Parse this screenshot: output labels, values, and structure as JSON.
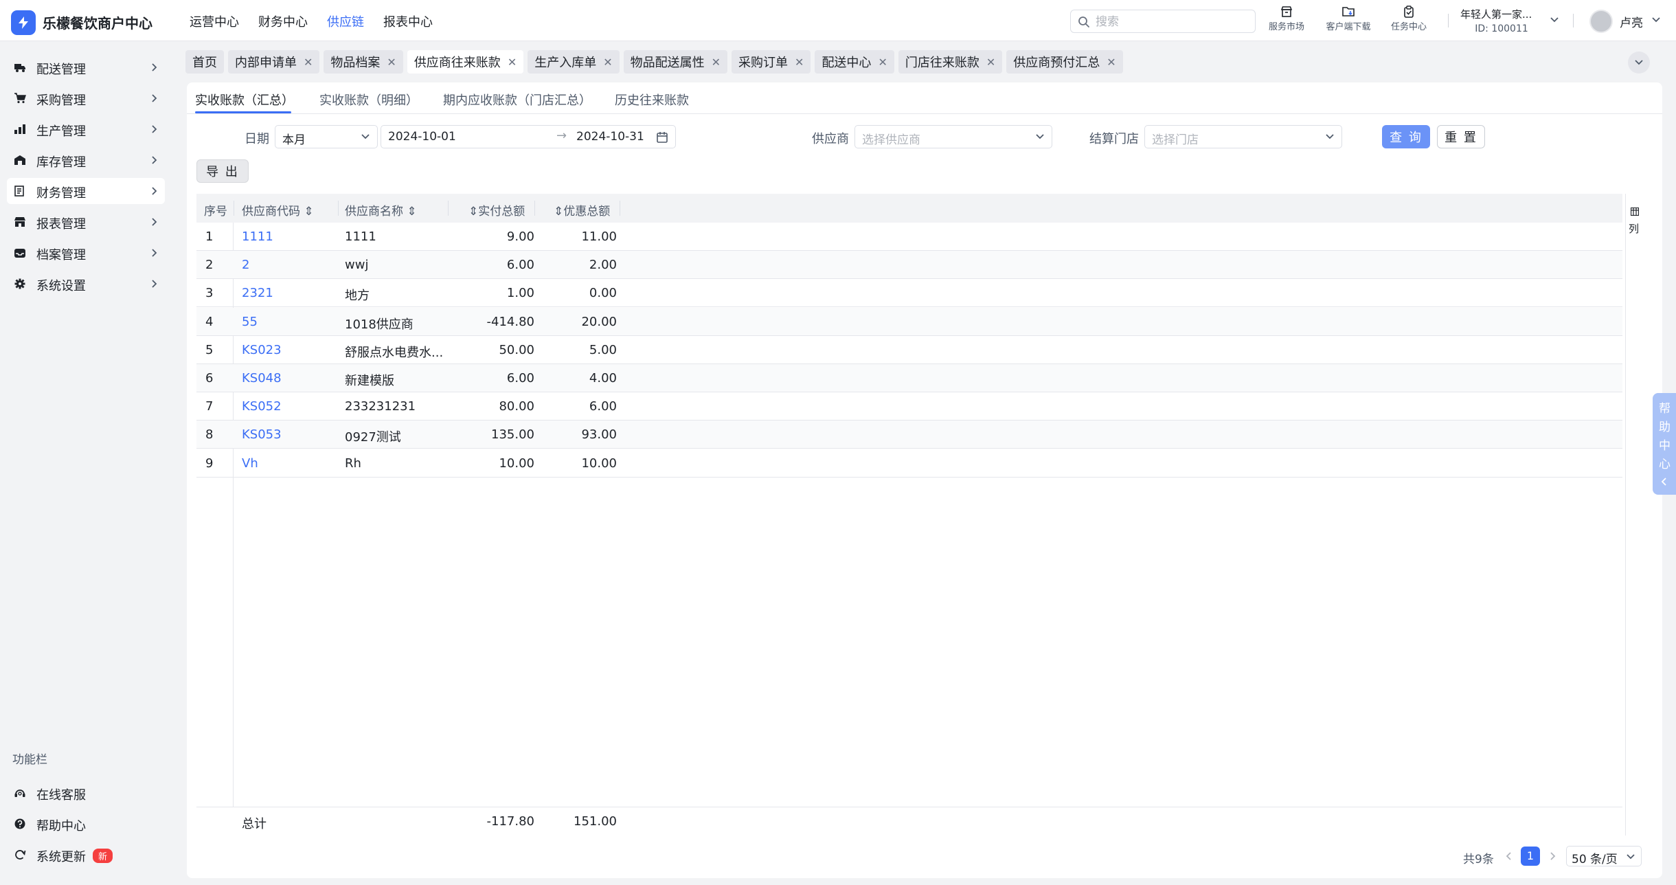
{
  "brand": {
    "name": "乐檬餐饮商户中心"
  },
  "topnav": [
    "运营中心",
    "财务中心",
    "供应链",
    "报表中心"
  ],
  "search": {
    "placeholder": "搜索"
  },
  "tools": {
    "market": "服务市场",
    "download": "客户端下载",
    "tasks": "任务中心"
  },
  "account": {
    "name": "年轻人第一家...",
    "id": "ID: 100011",
    "user": "卢亮"
  },
  "sidebar": {
    "items": [
      "配送管理",
      "采购管理",
      "生产管理",
      "库存管理",
      "财务管理",
      "报表管理",
      "档案管理",
      "系统设置"
    ],
    "section_title": "功能栏",
    "functions": [
      "在线客服",
      "帮助中心",
      "系统更新"
    ],
    "new_badge": "新"
  },
  "page_tabs": [
    "首页",
    "内部申请单",
    "物品档案",
    "供应商往来账款",
    "生产入库单",
    "物品配送属性",
    "采购订单",
    "配送中心",
    "门店往来账款",
    "供应商预付汇总"
  ],
  "sub_tabs": [
    "实收账款（汇总）",
    "实收账款（明细）",
    "期内应收账款（门店汇总）",
    "历史往来账款"
  ],
  "filters": {
    "date_label": "日期",
    "date_preset": "本月",
    "date_start": "2024-10-01",
    "date_end": "2024-10-31",
    "supplier_label": "供应商",
    "supplier_placeholder": "选择供应商",
    "store_label": "结算门店",
    "store_placeholder": "选择门店",
    "query": "查 询",
    "reset": "重 置",
    "export": "导 出"
  },
  "table": {
    "headers": [
      "序号",
      "供应商代码",
      "供应商名称",
      "实付总额",
      "优惠总额"
    ],
    "rows": [
      [
        "1",
        "1111",
        "1111",
        "9.00",
        "11.00"
      ],
      [
        "2",
        "2",
        "wwj",
        "6.00",
        "2.00"
      ],
      [
        "3",
        "2321",
        "地方",
        "1.00",
        "0.00"
      ],
      [
        "4",
        "55",
        "1018供应商",
        "-414.80",
        "20.00"
      ],
      [
        "5",
        "KS023",
        "舒服点水电费水...",
        "50.00",
        "5.00"
      ],
      [
        "6",
        "KS048",
        "新建模版",
        "6.00",
        "4.00"
      ],
      [
        "7",
        "KS052",
        "233231231",
        "80.00",
        "6.00"
      ],
      [
        "8",
        "KS053",
        "0927测试",
        "135.00",
        "93.00"
      ],
      [
        "9",
        "Vh",
        "Rh",
        "10.00",
        "10.00"
      ]
    ],
    "footer": {
      "label": "总计",
      "paid": "-117.80",
      "discount": "151.00"
    },
    "column_setting": "列"
  },
  "pagination": {
    "total": "共9条",
    "current": "1",
    "page_size": "50 条/页"
  },
  "help_float": [
    "帮",
    "助",
    "中",
    "心"
  ],
  "colors": {
    "primary": "#3b6ef5",
    "primary_light": "#6b93f7",
    "badge_red": "#f53f3f"
  }
}
